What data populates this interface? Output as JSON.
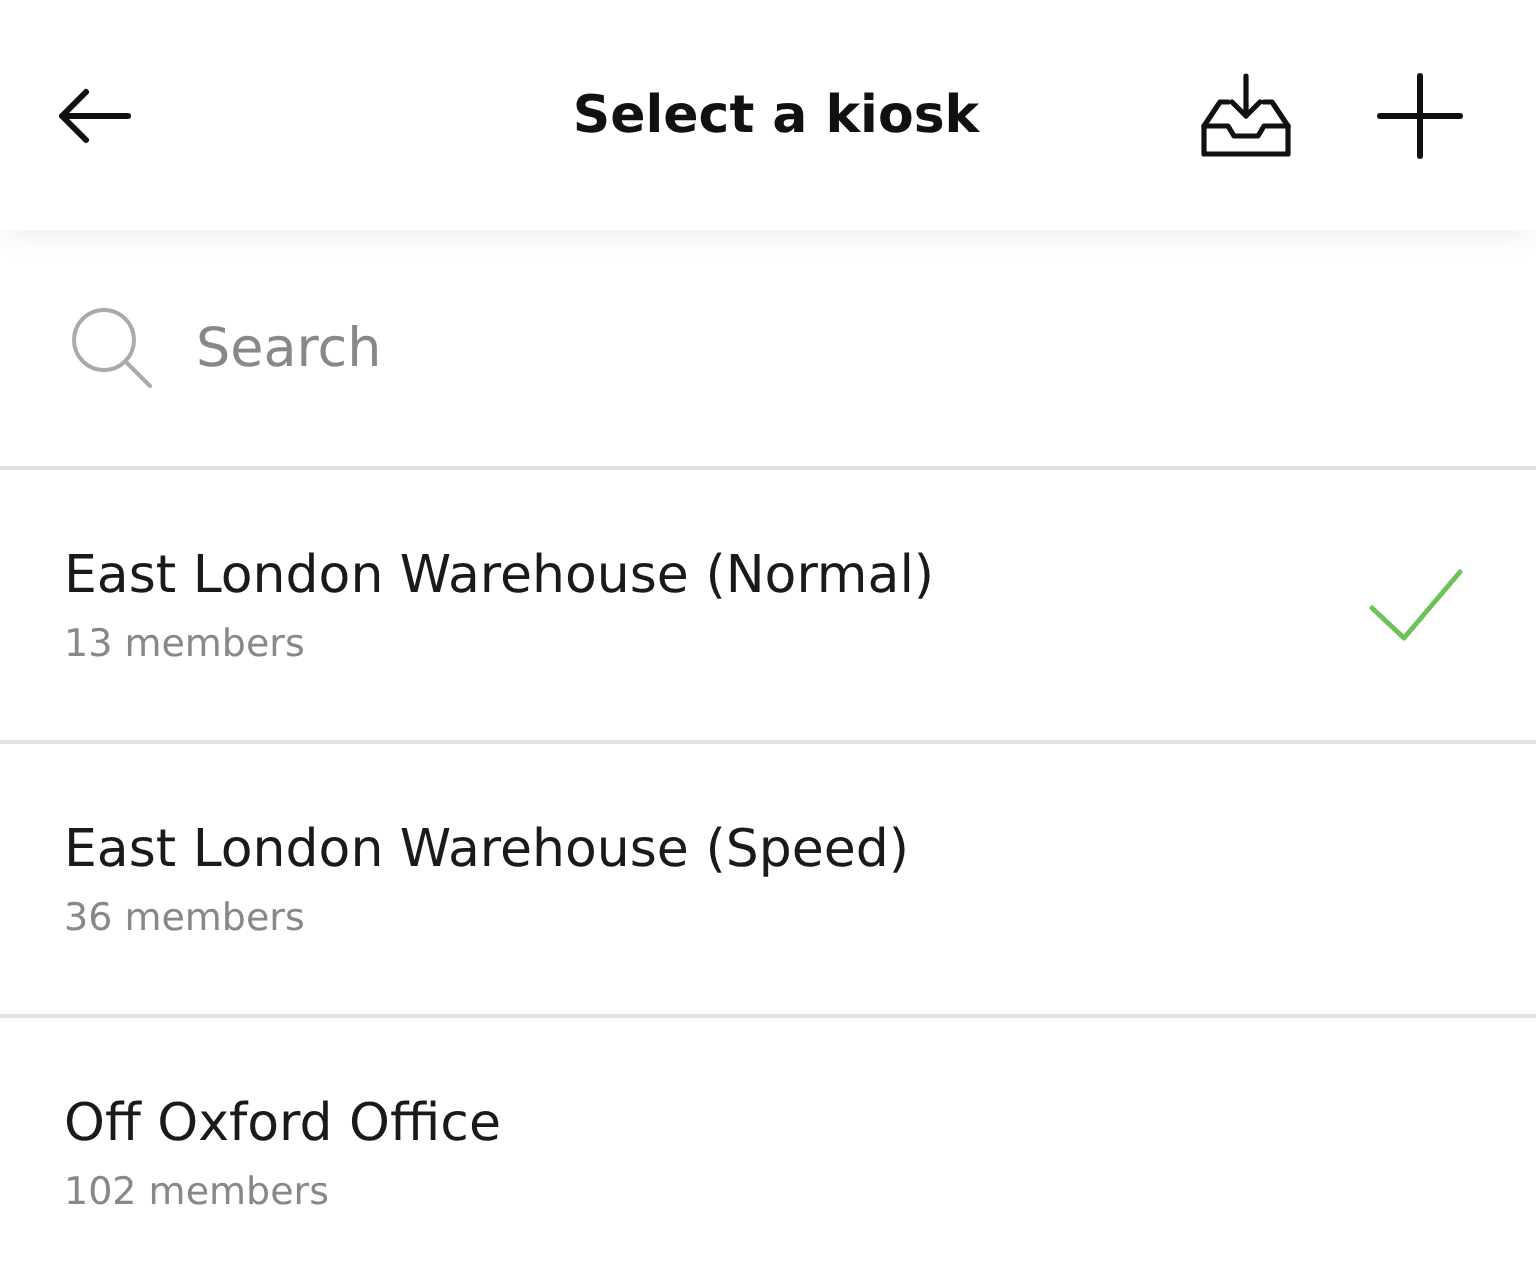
{
  "header": {
    "title": "Select a kiosk"
  },
  "search": {
    "placeholder": "Search"
  },
  "kiosks": [
    {
      "name": "East London Warehouse (Normal)",
      "members": "13 members",
      "selected": true
    },
    {
      "name": "East London Warehouse (Speed)",
      "members": "36 members",
      "selected": false
    },
    {
      "name": "Off Oxford Office",
      "members": "102 members",
      "selected": false
    }
  ]
}
